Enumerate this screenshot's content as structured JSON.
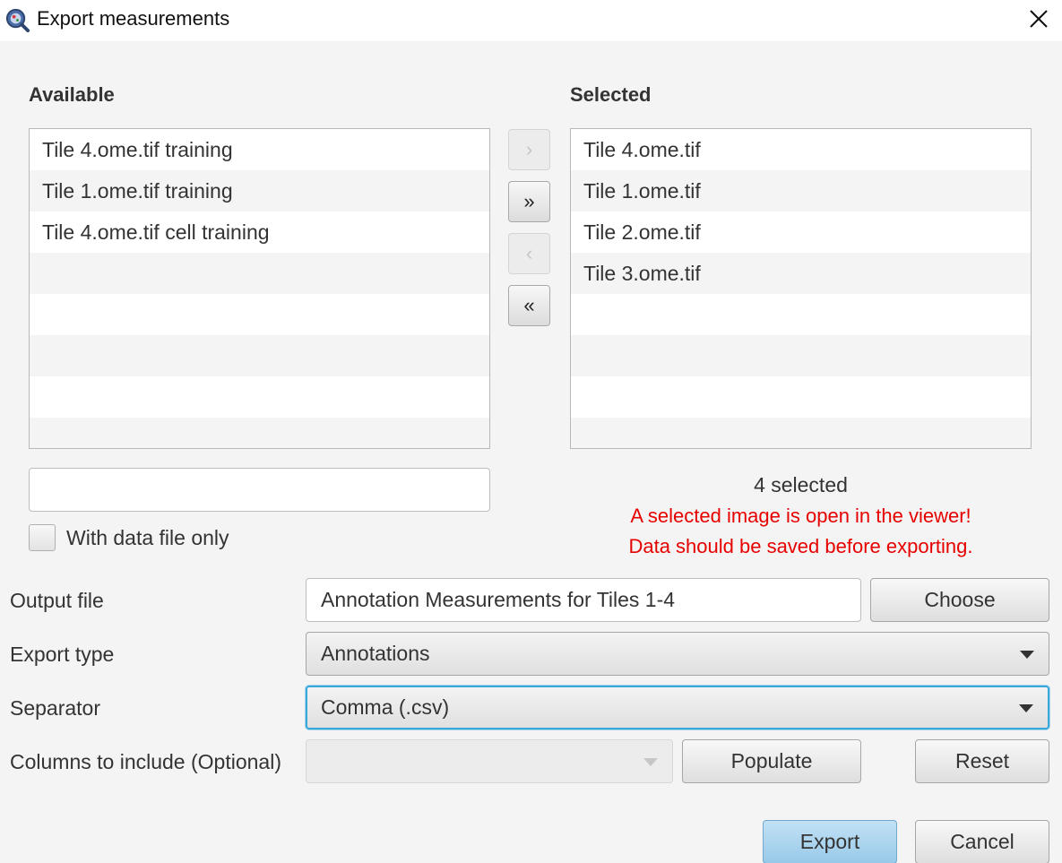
{
  "window": {
    "title": "Export measurements",
    "close_icon": "close-icon",
    "app_icon": "qupath-app-icon"
  },
  "available": {
    "heading": "Available",
    "items": [
      "Tile 4.ome.tif training",
      "Tile 1.ome.tif training",
      "Tile 4.ome.tif cell training",
      "",
      "",
      "",
      "",
      ""
    ],
    "filter_value": "",
    "checkbox_label": "With data file only",
    "checkbox_checked": false
  },
  "transfer": {
    "move_one_right": "›",
    "move_all_right": "»",
    "move_one_left": "‹",
    "move_all_left": "«"
  },
  "selected": {
    "heading": "Selected",
    "items": [
      "Tile 4.ome.tif",
      "Tile 1.ome.tif",
      "Tile 2.ome.tif",
      "Tile 3.ome.tif",
      "",
      "",
      "",
      ""
    ],
    "count_text": "4 selected",
    "warning_line1": "A selected image is open in the viewer!",
    "warning_line2": "Data should be saved before exporting.",
    "warning_color": "#e60000"
  },
  "form": {
    "output_label": "Output file",
    "output_value": "Annotation Measurements for Tiles 1-4",
    "choose_label": "Choose",
    "export_type_label": "Export type",
    "export_type_value": "Annotations",
    "separator_label": "Separator",
    "separator_value": "Comma (.csv)",
    "columns_label": "Columns to include (Optional)",
    "columns_value": "",
    "populate_label": "Populate",
    "reset_label": "Reset"
  },
  "footer": {
    "export_label": "Export",
    "cancel_label": "Cancel"
  },
  "colors": {
    "focus": "#3aa6dc",
    "primary_button": "#98c9e8"
  }
}
